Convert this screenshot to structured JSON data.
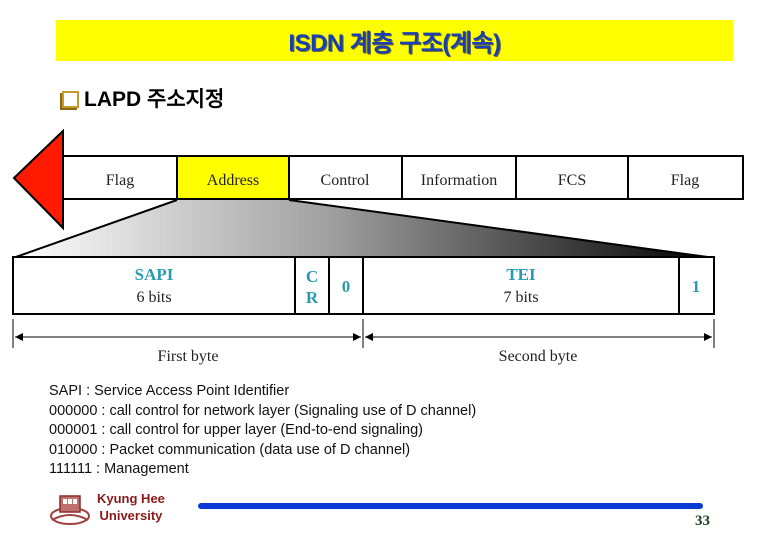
{
  "slide": {
    "title": "ISDN 계층 구조(계속)",
    "bullet": "LAPD 주소지정",
    "page_number": "33",
    "university": {
      "line1": "Kyung Hee",
      "line2": "University"
    }
  },
  "frame": {
    "fields": [
      "Flag",
      "Address",
      "Control",
      "Information",
      "FCS",
      "Flag"
    ],
    "highlighted_field": "Address",
    "colors": {
      "highlight": "#ffff00",
      "arrow": "#ff0000",
      "bit_label": "#2a9ab0"
    }
  },
  "address_field": {
    "sapi": {
      "name": "SAPI",
      "bits": "6 bits"
    },
    "cr": {
      "line1": "C",
      "line2": "R"
    },
    "ea0": "0",
    "tei": {
      "name": "TEI",
      "bits": "7 bits"
    },
    "ea1": "1",
    "first_byte_label": "First byte",
    "second_byte_label": "Second byte"
  },
  "description": [
    "SAPI : Service Access Point Identifier",
    "000000 : call control for network layer (Signaling use of D channel)",
    "000001 : call control for upper layer (End-to-end signaling)",
    "010000 : Packet communication (data use of D channel)",
    "111111 : Management"
  ]
}
